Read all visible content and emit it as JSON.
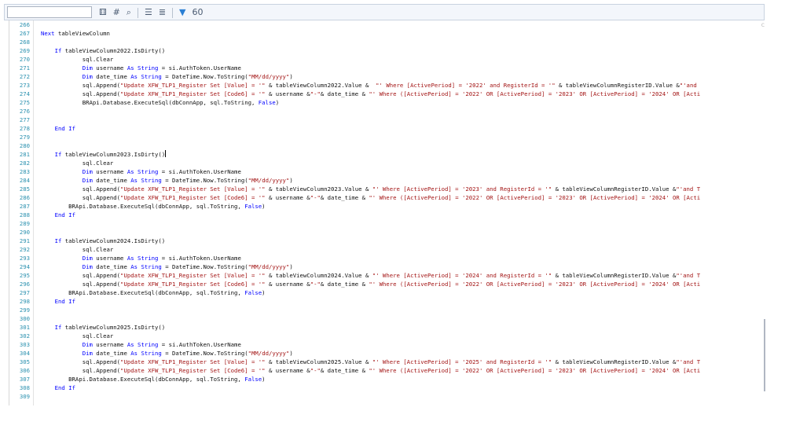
{
  "toolbar": {
    "search": {
      "value": "",
      "placeholder": ""
    },
    "icons": [
      {
        "name": "format-icon",
        "glyph": "⚅"
      },
      {
        "name": "hash-icon",
        "glyph": "#"
      },
      {
        "name": "find-replace-icon",
        "glyph": "⌕"
      },
      {
        "name": "comment-icon",
        "glyph": "☰"
      },
      {
        "name": "uncomment-icon",
        "glyph": "≣"
      },
      {
        "name": "filter-icon",
        "glyph": "▼"
      },
      {
        "name": "goto-icon",
        "glyph": "60"
      }
    ],
    "corner_mark": "c"
  },
  "editor": {
    "first_line": 266,
    "caret_line": 281,
    "lines": [
      "",
      "Next tableViewColumn",
      "",
      "    If tableViewColumn2022.IsDirty()",
      "            sql.Clear",
      "            Dim username As String = si.AuthToken.UserName",
      "            Dim date_time As String = DateTime.Now.ToString(\"MM/dd/yyyy\")",
      "            sql.Append(\"Update XFW_TLP1_Register Set [Value] = '\" & tableViewColumn2022.Value &  \"' Where [ActivePeriod] = '2022' and RegisterId = '\" & tableViewColumnRegisterID.Value &\"'and",
      "            sql.Append(\"Update XFW_TLP1_Register Set [Code6] = '\" & username &\"-\"& date_time & \"' Where ([ActivePeriod] = '2022' OR [ActivePeriod] = '2023' OR [ActivePeriod] = '2024' OR [Acti",
      "            BRApi.Database.ExecuteSql(dbConnApp, sql.ToString, False)",
      "",
      "",
      "    End If",
      "",
      "",
      "    If tableViewColumn2023.IsDirty()",
      "            sql.Clear",
      "            Dim username As String = si.AuthToken.UserName",
      "            Dim date_time As String = DateTime.Now.ToString(\"MM/dd/yyyy\")",
      "            sql.Append(\"Update XFW_TLP1_Register Set [Value] = '\" & tableViewColumn2023.Value & \"' Where [ActivePeriod] = '2023' and RegisterId = '\" & tableViewColumnRegisterID.Value &\"'and T",
      "            sql.Append(\"Update XFW_TLP1_Register Set [Code6] = '\" & username &\"-\"& date_time & \"' Where ([ActivePeriod] = '2022' OR [ActivePeriod] = '2023' OR [ActivePeriod] = '2024' OR [Acti",
      "        BRApi.Database.ExecuteSql(dbConnApp, sql.ToString, False)",
      "    End If",
      "",
      "",
      "    If tableViewColumn2024.IsDirty()",
      "            sql.Clear",
      "            Dim username As String = si.AuthToken.UserName",
      "            Dim date_time As String = DateTime.Now.ToString(\"MM/dd/yyyy\")",
      "            sql.Append(\"Update XFW_TLP1_Register Set [Value] = '\" & tableViewColumn2024.Value & \"' Where [ActivePeriod] = '2024' and RegisterId = '\" & tableViewColumnRegisterID.Value &\"'and T",
      "            sql.Append(\"Update XFW_TLP1_Register Set [Code6] = '\" & username &\"-\"& date_time & \"' Where ([ActivePeriod] = '2022' OR [ActivePeriod] = '2023' OR [ActivePeriod] = '2024' OR [Acti",
      "        BRApi.Database.ExecuteSql(dbConnApp, sql.ToString, False)",
      "    End If",
      "",
      "",
      "    If tableViewColumn2025.IsDirty()",
      "            sql.Clear",
      "            Dim username As String = si.AuthToken.UserName",
      "            Dim date_time As String = DateTime.Now.ToString(\"MM/dd/yyyy\")",
      "            sql.Append(\"Update XFW_TLP1_Register Set [Value] = '\" & tableViewColumn2025.Value & \"' Where [ActivePeriod] = '2025' and RegisterId = '\" & tableViewColumnRegisterID.Value &\"'and T",
      "            sql.Append(\"Update XFW_TLP1_Register Set [Code6] = '\" & username &\"-\"& date_time & \"' Where ([ActivePeriod] = '2022' OR [ActivePeriod] = '2023' OR [ActivePeriod] = '2024' OR [Acti",
      "        BRApi.Database.ExecuteSql(dbConnApp, sql.ToString, False)",
      "    End If",
      ""
    ]
  },
  "colors": {
    "keyword": "#0000ff",
    "string": "#a31515",
    "line_number": "#2b91af",
    "text": "#111111",
    "toolbar_bg": "#f3f6fb"
  }
}
